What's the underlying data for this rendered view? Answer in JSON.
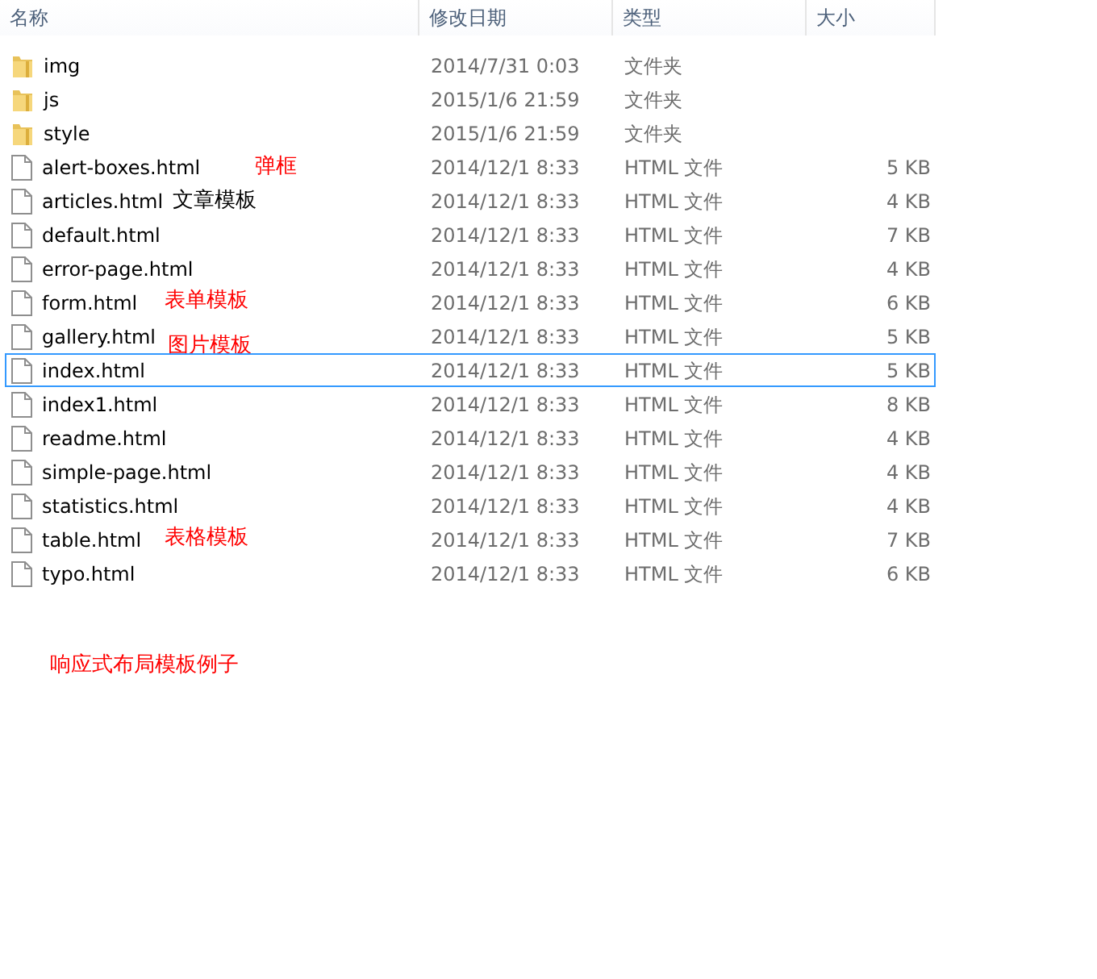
{
  "columns": [
    "名称",
    "修改日期",
    "类型",
    "大小"
  ],
  "rows": [
    {
      "kind": "folder",
      "name": "img",
      "date": "2014/7/31 0:03",
      "type": "文件夹",
      "selected": false
    },
    {
      "kind": "folder",
      "name": "js",
      "date": "2015/1/6 21:59",
      "type": "文件夹",
      "selected": false
    },
    {
      "kind": "folder",
      "name": "style",
      "date": "2015/1/6 21:59",
      "type": "文件夹",
      "selected": false
    },
    {
      "kind": "file",
      "name": "alert-boxes.html",
      "note": {
        "text": "弹框",
        "color": "#ff0000"
      },
      "date": "2014/12/1 8:33",
      "type": "HTML 文件",
      "size": "5 KB",
      "selected": false
    },
    {
      "kind": "file",
      "name": "articles.html",
      "note": {
        "text": "文章模板",
        "color": "#000000"
      },
      "date": "2014/12/1 8:33",
      "type": "HTML 文件",
      "size": "4 KB",
      "selected": false
    },
    {
      "kind": "file",
      "name": "default.html",
      "date": "2014/12/1 8:33",
      "type": "HTML 文件",
      "size": "7 KB",
      "selected": false
    },
    {
      "kind": "file",
      "name": "error-page.html",
      "date": "2014/12/1 8:33",
      "type": "HTML 文件",
      "size": "4 KB",
      "selected": false
    },
    {
      "kind": "file",
      "name": "form.html",
      "note": {
        "text": "表单模板",
        "color": "#ff0000"
      },
      "date": "2014/12/1 8:33",
      "type": "HTML 文件",
      "size": "6 KB",
      "selected": false
    },
    {
      "kind": "file",
      "name": "gallery.html",
      "note": {
        "text": "图片模板",
        "color": "#ff0000"
      },
      "date": "2014/12/1 8:33",
      "type": "HTML 文件",
      "size": "5 KB",
      "selected": false
    },
    {
      "kind": "file",
      "name": "index.html",
      "date": "2014/12/1 8:33",
      "type": "HTML 文件",
      "size": "5 KB",
      "selected": true
    },
    {
      "kind": "file",
      "name": "index1.html",
      "date": "2014/12/1 8:33",
      "type": "HTML 文件",
      "size": "8 KB",
      "selected": false
    },
    {
      "kind": "file",
      "name": "readme.html",
      "date": "2014/12/1 8:33",
      "type": "HTML 文件",
      "size": "4 KB",
      "selected": false
    },
    {
      "kind": "file",
      "name": "simple-page.html",
      "date": "2014/12/1 8:33",
      "type": "HTML 文件",
      "size": "4 KB",
      "selected": false
    },
    {
      "kind": "file",
      "name": "statistics.html",
      "date": "2014/12/1 8:33",
      "type": "HTML 文件",
      "size": "4 KB",
      "selected": false
    },
    {
      "kind": "file",
      "name": "table.html",
      "note": {
        "text": "表格模板",
        "color": "#ff0000"
      },
      "date": "2014/12/1 8:33",
      "type": "HTML 文件",
      "size": "7 KB",
      "selected": false
    },
    {
      "kind": "file",
      "name": "typo.html",
      "date": "2014/12/1 8:33",
      "type": "HTML 文件",
      "size": "6 KB",
      "selected": false
    }
  ],
  "footer_note": {
    "text": "响应式布局模板例子",
    "color": "#ff0000"
  }
}
